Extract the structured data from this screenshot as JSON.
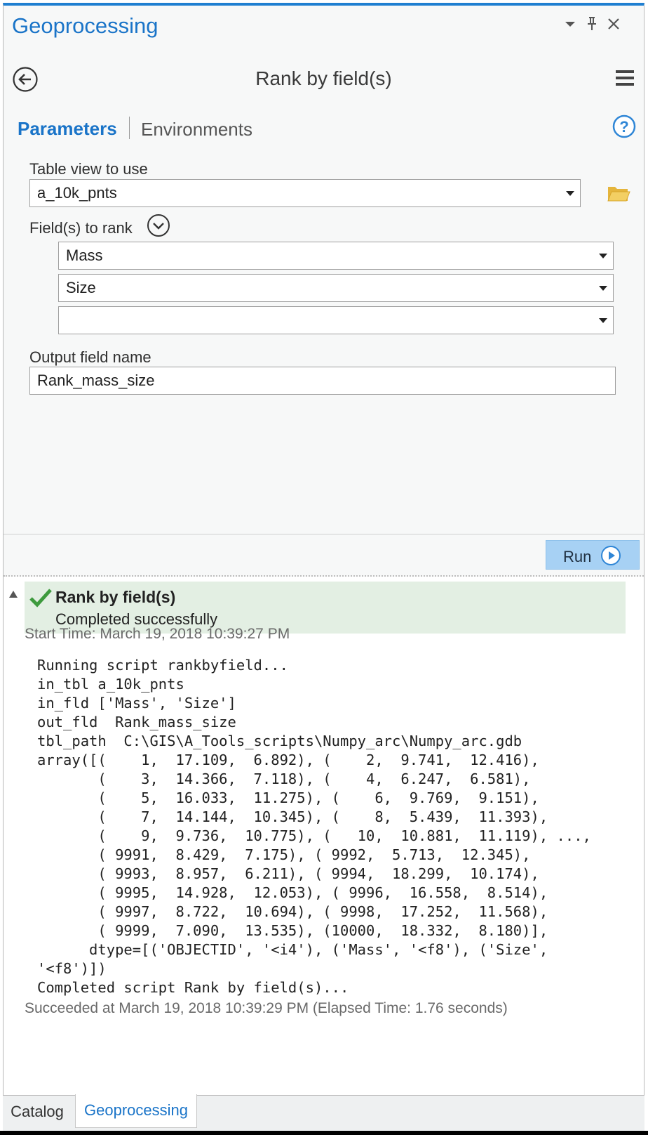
{
  "pane": {
    "title": "Geoprocessing",
    "icons": [
      "dropdown-icon",
      "pin-icon",
      "close-icon"
    ]
  },
  "tool": {
    "title": "Rank by field(s)",
    "tabs": {
      "parameters": "Parameters",
      "environments": "Environments"
    }
  },
  "params": {
    "table_view_label": "Table view to use",
    "table_view_value": "a_10k_pnts",
    "fields_label": "Field(s) to rank",
    "fields": [
      "Mass",
      "Size",
      ""
    ],
    "output_label": "Output field name",
    "output_value": "Rank_mass_size"
  },
  "run_label": "Run",
  "result": {
    "title": "Rank by field(s)",
    "status": "Completed successfully",
    "start_time": "Start Time: March 19, 2018 10:39:27 PM",
    "log": [
      "Running script rankbyfield...",
      "in_tbl a_10k_pnts",
      "in_fld ['Mass', 'Size']",
      "out_fld  Rank_mass_size",
      "tbl_path  C:\\GIS\\A_Tools_scripts\\Numpy_arc\\Numpy_arc.gdb",
      "array([(    1,  17.109,  6.892), (    2,  9.741,  12.416),",
      "       (    3,  14.366,  7.118), (    4,  6.247,  6.581),",
      "       (    5,  16.033,  11.275), (    6,  9.769,  9.151),",
      "       (    7,  14.144,  10.345), (    8,  5.439,  11.393),",
      "       (    9,  9.736,  10.775), (   10,  10.881,  11.119), ...,",
      "       ( 9991,  8.429,  7.175), ( 9992,  5.713,  12.345),",
      "       ( 9993,  8.957,  6.211), ( 9994,  18.299,  10.174),",
      "       ( 9995,  14.928,  12.053), ( 9996,  16.558,  8.514),",
      "       ( 9997,  8.722,  10.694), ( 9998,  17.252,  11.568),",
      "       ( 9999,  7.090,  13.535), (10000,  18.332,  8.180)],",
      "      dtype=[('OBJECTID', '<i4'), ('Mass', '<f8'), ('Size',",
      "'<f8')])",
      "Completed script Rank by field(s)..."
    ],
    "succeeded": "Succeeded at March 19, 2018 10:39:29 PM (Elapsed Time: 1.76 seconds)"
  },
  "bottom_tabs": {
    "catalog": "Catalog",
    "geoprocessing": "Geoprocessing"
  },
  "colors": {
    "accent": "#1a74c8",
    "run_button": "#a7d1f4",
    "success_bg": "#e3efe3",
    "success_check": "#3d9a3d"
  }
}
